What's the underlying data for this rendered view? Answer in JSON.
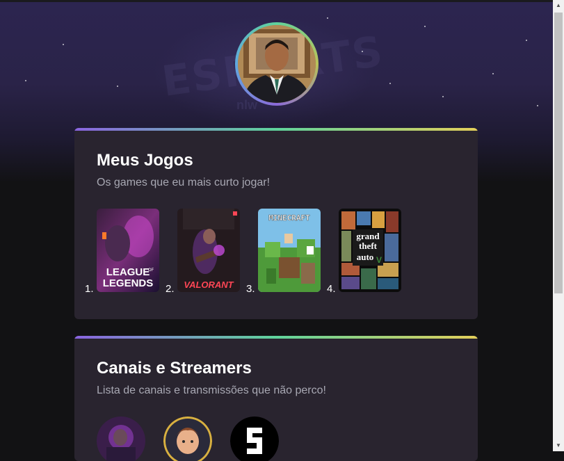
{
  "profile": {
    "avatar_icon": "profile-photo"
  },
  "games_section": {
    "title": "Meus Jogos",
    "subtitle": "Os games que eu mais curto jogar!",
    "items": [
      {
        "number": "1.",
        "cover_text_1": "LEAGUE",
        "cover_text_2": "OF",
        "cover_text_3": "LEGENDS"
      },
      {
        "number": "2.",
        "cover_text_1": "VALORANT"
      },
      {
        "number": "3.",
        "cover_text_1": "MINECRAFT"
      },
      {
        "number": "4.",
        "cover_text_1": "grand",
        "cover_text_2": "theft",
        "cover_text_3": "auto",
        "cover_text_4": "V"
      }
    ]
  },
  "channels_section": {
    "title": "Canais e Streamers",
    "subtitle": "Lista de canais e transmissões que não perco!",
    "items": [
      {
        "icon": "streamer-avatar-1"
      },
      {
        "icon": "streamer-avatar-2"
      },
      {
        "icon": "streamer-avatar-3"
      }
    ]
  },
  "colors": {
    "page_bg": "#121214",
    "card_bg": "#29242f",
    "subtitle": "#a8a8b3",
    "gradient": [
      "#8a64e0",
      "#5fd39c",
      "#e3cf5a"
    ]
  }
}
